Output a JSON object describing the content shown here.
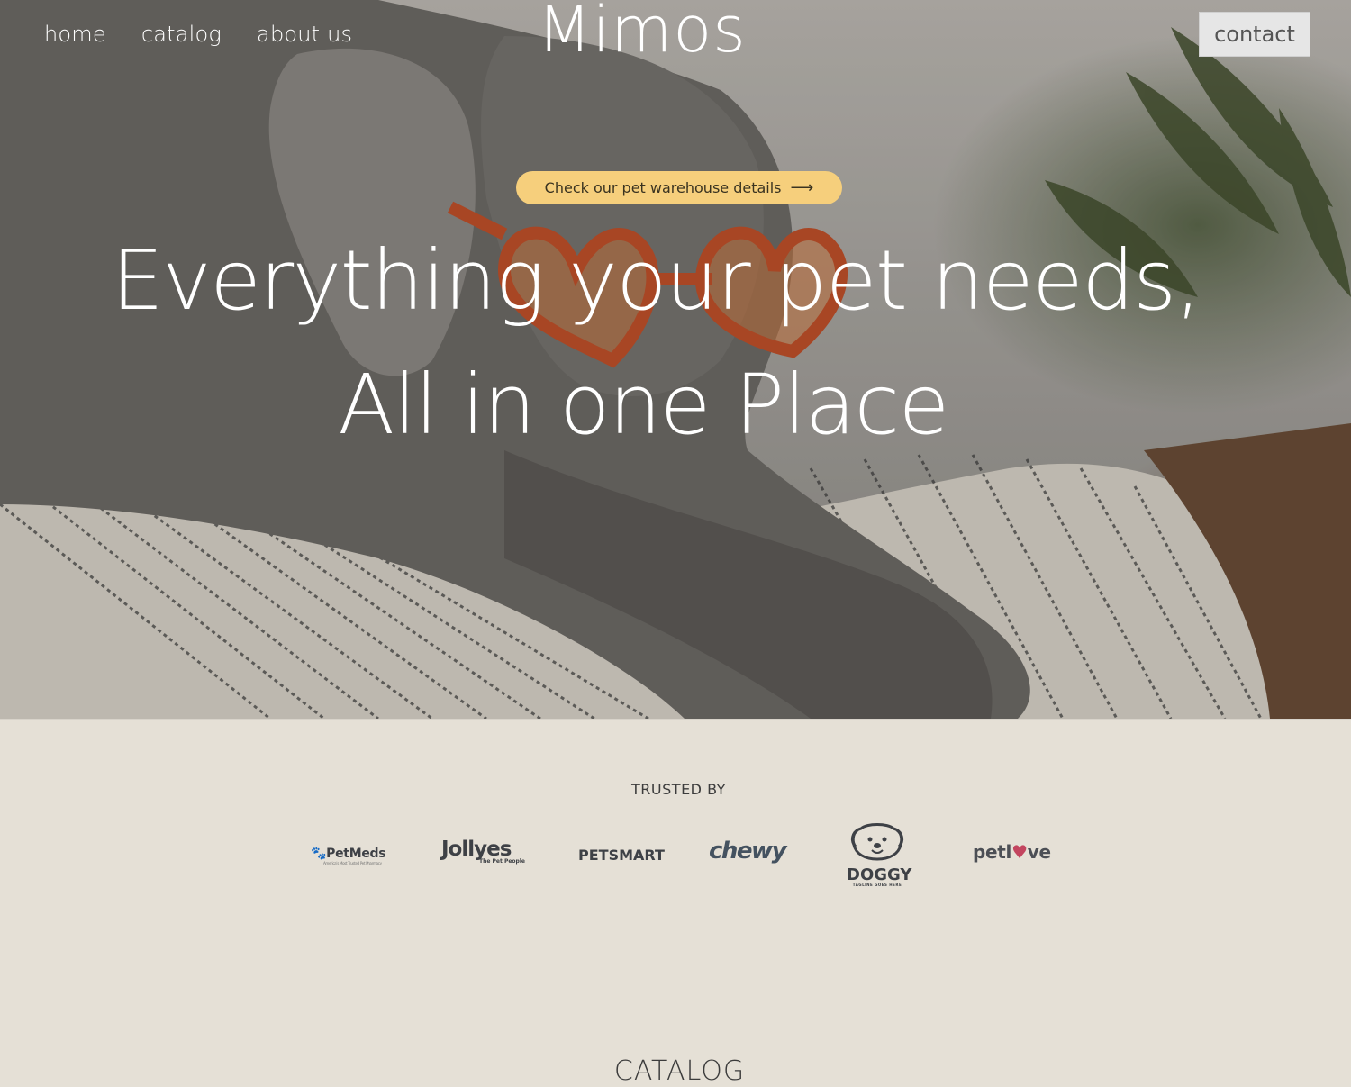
{
  "nav": {
    "items": [
      {
        "label": "home"
      },
      {
        "label": "catalog"
      },
      {
        "label": "about us"
      }
    ],
    "brand": "Mimos",
    "contact_label": "contact"
  },
  "hero": {
    "pill_label": "Check our pet warehouse details",
    "pill_arrow": "⟶",
    "headline_line1": "Everything your pet needs,",
    "headline_line2": "All in one Place"
  },
  "trusted": {
    "title": "TRUSTED BY",
    "logos": [
      {
        "name": "PetMeds",
        "tagline": "America's Most Trusted Pet Pharmacy"
      },
      {
        "name": "Jollyes",
        "tagline": "The Pet People"
      },
      {
        "name": "PETSMART"
      },
      {
        "name": "chewy"
      },
      {
        "name": "DOGGY",
        "tagline": "TAGLINE GOES HERE"
      },
      {
        "name_left": "petl",
        "name_heart": "♥",
        "name_right": "ve"
      }
    ]
  },
  "catalog": {
    "title": "CATALOG"
  },
  "colors": {
    "pill": "#f6cf7c",
    "section_bg": "#e5e0d6",
    "contact_bg": "#e6e6e6",
    "glasses": "#c0502a"
  }
}
